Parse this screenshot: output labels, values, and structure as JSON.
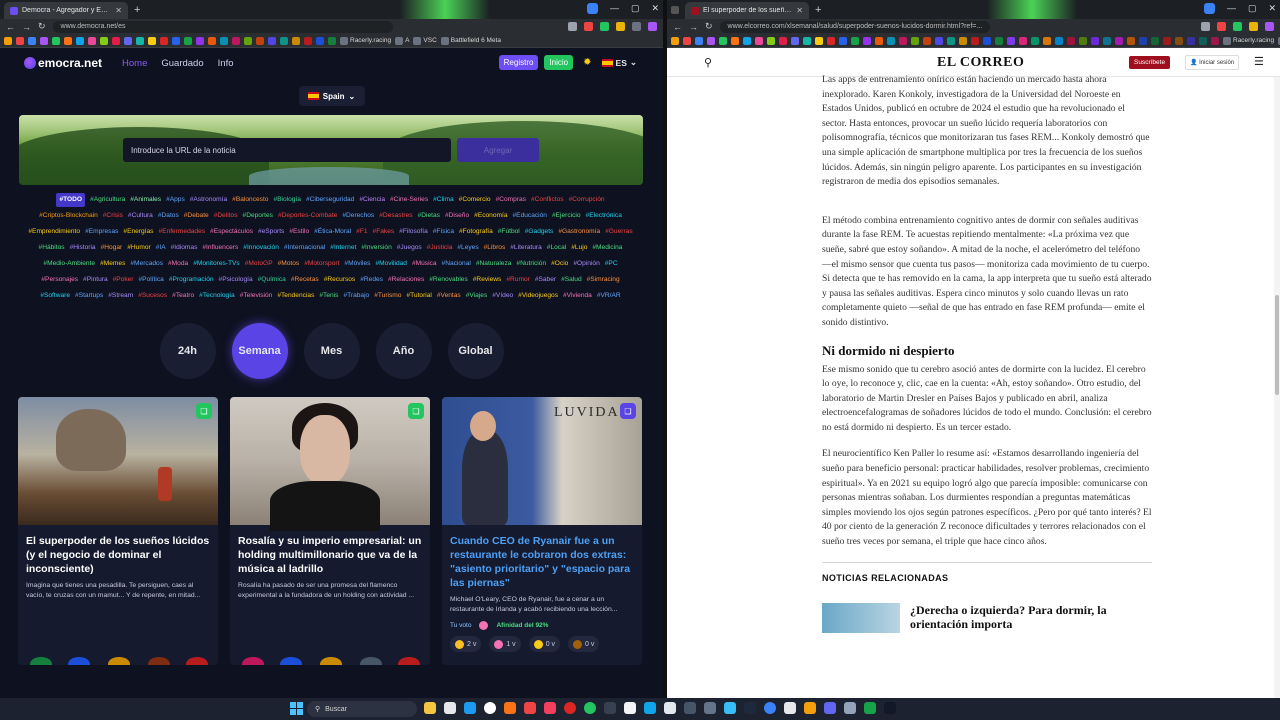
{
  "left_browser": {
    "tab_title": "Democra - Agregador y Evalua...",
    "url": "www.democra.net/es",
    "bookmarks": [
      "Racerly.racing",
      "A",
      "VSC",
      "Battlefield 6 Meta"
    ]
  },
  "right_browser": {
    "tab_title": "El superpoder de los sueños lú...",
    "url": "www.elcorreo.com/xlsemanal/salud/superpoder-suenos-lucidos-dormir.html?ref=...",
    "bookmarks": [
      "Racerly.racing",
      "A"
    ]
  },
  "democra": {
    "logo": "emocra.net",
    "nav": {
      "home": "Home",
      "saved": "Guardado",
      "info": "Info"
    },
    "register": "Registro",
    "login": "Inicio",
    "lang": "ES",
    "country": "Spain",
    "url_placeholder": "Introduce la URL de la noticia",
    "add_button": "Agregar",
    "tags": [
      {
        "t": "#TODO",
        "c": "#ffffff"
      },
      {
        "t": "#Agricultura",
        "c": "#4ade80"
      },
      {
        "t": "#Animales",
        "c": "#86efac"
      },
      {
        "t": "#Apps",
        "c": "#60a5fa"
      },
      {
        "t": "#Astronomía",
        "c": "#a78bfa"
      },
      {
        "t": "#Baloncesto",
        "c": "#fb923c"
      },
      {
        "t": "#Biología",
        "c": "#34d399"
      },
      {
        "t": "#Ciberseguridad",
        "c": "#60a5fa"
      },
      {
        "t": "#Ciencia",
        "c": "#c084fc"
      },
      {
        "t": "#Cine-Series",
        "c": "#f472b6"
      },
      {
        "t": "#Clima",
        "c": "#22d3ee"
      },
      {
        "t": "#Comercio",
        "c": "#facc15"
      },
      {
        "t": "#Compras",
        "c": "#f472b6"
      },
      {
        "t": "#Conflictos",
        "c": "#ef4444"
      },
      {
        "t": "#Corrupción",
        "c": "#ef4444"
      },
      {
        "t": "#Criptos-Blockchain",
        "c": "#f59e0b"
      },
      {
        "t": "#Crisis",
        "c": "#ef4444"
      },
      {
        "t": "#Cultura",
        "c": "#a78bfa"
      },
      {
        "t": "#Datos",
        "c": "#60a5fa"
      },
      {
        "t": "#Debate",
        "c": "#fb923c"
      },
      {
        "t": "#Delitos",
        "c": "#ef4444"
      },
      {
        "t": "#Deportes",
        "c": "#4ade80"
      },
      {
        "t": "#Deportes-Combate",
        "c": "#ef4444"
      },
      {
        "t": "#Derechos",
        "c": "#60a5fa"
      },
      {
        "t": "#Desastres",
        "c": "#ef4444"
      },
      {
        "t": "#Dietas",
        "c": "#4ade80"
      },
      {
        "t": "#Diseño",
        "c": "#f472b6"
      },
      {
        "t": "#Economía",
        "c": "#facc15"
      },
      {
        "t": "#Educación",
        "c": "#60a5fa"
      },
      {
        "t": "#Ejercicio",
        "c": "#4ade80"
      },
      {
        "t": "#Electrónica",
        "c": "#22d3ee"
      },
      {
        "t": "#Emprendimiento",
        "c": "#facc15"
      },
      {
        "t": "#Empresas",
        "c": "#60a5fa"
      },
      {
        "t": "#Energías",
        "c": "#facc15"
      },
      {
        "t": "#Enfermedades",
        "c": "#ef4444"
      },
      {
        "t": "#Espectáculos",
        "c": "#f472b6"
      },
      {
        "t": "#eSports",
        "c": "#a78bfa"
      },
      {
        "t": "#Estilo",
        "c": "#f472b6"
      },
      {
        "t": "#Ética-Moral",
        "c": "#60a5fa"
      },
      {
        "t": "#F1",
        "c": "#ef4444"
      },
      {
        "t": "#Fakes",
        "c": "#ef4444"
      },
      {
        "t": "#Filosofía",
        "c": "#a78bfa"
      },
      {
        "t": "#Física",
        "c": "#60a5fa"
      },
      {
        "t": "#Fotografía",
        "c": "#facc15"
      },
      {
        "t": "#Fútbol",
        "c": "#4ade80"
      },
      {
        "t": "#Gadgets",
        "c": "#22d3ee"
      },
      {
        "t": "#Gastronomía",
        "c": "#fb923c"
      },
      {
        "t": "#Guerras",
        "c": "#ef4444"
      },
      {
        "t": "#Hábitos",
        "c": "#4ade80"
      },
      {
        "t": "#Historia",
        "c": "#a78bfa"
      },
      {
        "t": "#Hogar",
        "c": "#fb923c"
      },
      {
        "t": "#Humor",
        "c": "#facc15"
      },
      {
        "t": "#IA",
        "c": "#60a5fa"
      },
      {
        "t": "#Idiomas",
        "c": "#a78bfa"
      },
      {
        "t": "#Influencers",
        "c": "#f472b6"
      },
      {
        "t": "#Innovación",
        "c": "#22d3ee"
      },
      {
        "t": "#Internacional",
        "c": "#60a5fa"
      },
      {
        "t": "#Internet",
        "c": "#22d3ee"
      },
      {
        "t": "#Inversión",
        "c": "#4ade80"
      },
      {
        "t": "#Juegos",
        "c": "#a78bfa"
      },
      {
        "t": "#Justicia",
        "c": "#ef4444"
      },
      {
        "t": "#Leyes",
        "c": "#60a5fa"
      },
      {
        "t": "#Libros",
        "c": "#fb923c"
      },
      {
        "t": "#Literatura",
        "c": "#a78bfa"
      },
      {
        "t": "#Local",
        "c": "#4ade80"
      },
      {
        "t": "#Lujo",
        "c": "#facc15"
      },
      {
        "t": "#Medicina",
        "c": "#4ade80"
      },
      {
        "t": "#Medio-Ambiente",
        "c": "#4ade80"
      },
      {
        "t": "#Memes",
        "c": "#facc15"
      },
      {
        "t": "#Mercados",
        "c": "#60a5fa"
      },
      {
        "t": "#Moda",
        "c": "#f472b6"
      },
      {
        "t": "#Monitores-TVs",
        "c": "#22d3ee"
      },
      {
        "t": "#MotoGP",
        "c": "#ef4444"
      },
      {
        "t": "#Motos",
        "c": "#fb923c"
      },
      {
        "t": "#Motorsport",
        "c": "#ef4444"
      },
      {
        "t": "#Móviles",
        "c": "#60a5fa"
      },
      {
        "t": "#Movilidad",
        "c": "#22d3ee"
      },
      {
        "t": "#Música",
        "c": "#f472b6"
      },
      {
        "t": "#Nacional",
        "c": "#60a5fa"
      },
      {
        "t": "#Naturaleza",
        "c": "#4ade80"
      },
      {
        "t": "#Nutrición",
        "c": "#4ade80"
      },
      {
        "t": "#Ocio",
        "c": "#facc15"
      },
      {
        "t": "#Opinión",
        "c": "#a78bfa"
      },
      {
        "t": "#PC",
        "c": "#22d3ee"
      },
      {
        "t": "#Personajes",
        "c": "#f472b6"
      },
      {
        "t": "#Pintura",
        "c": "#a78bfa"
      },
      {
        "t": "#Poker",
        "c": "#ef4444"
      },
      {
        "t": "#Política",
        "c": "#60a5fa"
      },
      {
        "t": "#Programación",
        "c": "#22d3ee"
      },
      {
        "t": "#Psicología",
        "c": "#a78bfa"
      },
      {
        "t": "#Química",
        "c": "#34d399"
      },
      {
        "t": "#Recetas",
        "c": "#fb923c"
      },
      {
        "t": "#Recursos",
        "c": "#facc15"
      },
      {
        "t": "#Redes",
        "c": "#60a5fa"
      },
      {
        "t": "#Relaciones",
        "c": "#f472b6"
      },
      {
        "t": "#Renovables",
        "c": "#4ade80"
      },
      {
        "t": "#Reviews",
        "c": "#facc15"
      },
      {
        "t": "#Rumor",
        "c": "#ef4444"
      },
      {
        "t": "#Saber",
        "c": "#a78bfa"
      },
      {
        "t": "#Salud",
        "c": "#4ade80"
      },
      {
        "t": "#Simracing",
        "c": "#fb923c"
      },
      {
        "t": "#Software",
        "c": "#22d3ee"
      },
      {
        "t": "#Startups",
        "c": "#60a5fa"
      },
      {
        "t": "#Stream",
        "c": "#a78bfa"
      },
      {
        "t": "#Sucesos",
        "c": "#ef4444"
      },
      {
        "t": "#Teatro",
        "c": "#f472b6"
      },
      {
        "t": "#Tecnología",
        "c": "#22d3ee"
      },
      {
        "t": "#Televisión",
        "c": "#f472b6"
      },
      {
        "t": "#Tendencias",
        "c": "#facc15"
      },
      {
        "t": "#Tenis",
        "c": "#4ade80"
      },
      {
        "t": "#Trabajo",
        "c": "#60a5fa"
      },
      {
        "t": "#Turismo",
        "c": "#fb923c"
      },
      {
        "t": "#Tutorial",
        "c": "#facc15"
      },
      {
        "t": "#Ventas",
        "c": "#fb923c"
      },
      {
        "t": "#Viajes",
        "c": "#4ade80"
      },
      {
        "t": "#Vídeo",
        "c": "#a78bfa"
      },
      {
        "t": "#Videojuegos",
        "c": "#facc15"
      },
      {
        "t": "#Vivienda",
        "c": "#f472b6"
      },
      {
        "t": "#VR/AR",
        "c": "#60a5fa"
      }
    ],
    "periods": [
      "24h",
      "Semana",
      "Mes",
      "Año",
      "Global"
    ],
    "active_period": "Semana",
    "cards": [
      {
        "title": "El superpoder de los sueños lúcidos (y el negocio de dominar el inconsciente)",
        "summary": "Imagina que tienes una pesadilla. Te persiguen, caes al vacío, te cruzas con un mamut... Y de repente, en mitad...",
        "bookmark_color": "#22c55e"
      },
      {
        "title": "Rosalía y su imperio empresarial: un holding multimillonario que va de la música al ladrillo",
        "summary": "Rosalía ha pasado de ser una promesa del flamenco experimental a la fundadora de un holding con actividad ...",
        "bookmark_color": "#22c55e"
      },
      {
        "title": "Cuando CEO de Ryanair fue a un restaurante le cobraron dos extras: \"asiento prioritario\" y \"espacio para las piernas\"",
        "summary": "Michael O'Leary, CEO de Ryanair, fue a cenar a un restaurante de Irlanda y acabó recibiendo una lección...",
        "bookmark_color": "#5b44e6",
        "your_vote": "Tu voto",
        "affinity": "Afinidad del 92%",
        "sign": "LUVIDA",
        "reactions": [
          "2 v",
          "1 v",
          "0 v",
          "0 v"
        ]
      }
    ]
  },
  "elcorreo": {
    "logo": "EL CORREO",
    "subscribe": "Suscríbete",
    "login": "Iniciar sesión",
    "p1": "Las apps de entrenamiento onírico están haciendo un mercado hasta ahora inexplorado. Karen Konkoly, investigadora de la Universidad del Noroeste en Estados Unidos, publicó en octubre de 2024 el estudio que ha revolucionado el sector. Hasta entonces, provocar un sueño lúcido requería laboratorios con polisomnografía, técnicos que monitorizaran tus fases REM... Konkoly demostró que una simple aplicación de smartphone multiplica por tres la frecuencia de los sueños lúcidos. Además, sin ningún peligro aparente. Los participantes en su investigación registraron de media dos episodios semanales.",
    "p2": "El método combina entrenamiento cognitivo antes de dormir con señales auditivas durante la fase REM. Te acuestas repitiendo mentalmente: «La próxima vez que sueñe, sabré que estoy soñando». A mitad de la noche, el acelerómetro del teléfono —el mismo sensor que cuenta tus pasos— monitoriza cada movimiento de tu cuerpo. Si detecta que te has removido en la cama, la app interpreta que tu sueño está alterado y pausa las señales auditivas. Espera cinco minutos y solo cuando llevas un rato completamente quieto —señal de que has entrado en fase REM profunda— emite el sonido distintivo.",
    "h2": "Ni dormido ni despierto",
    "p3": "Ese mismo sonido que tu cerebro asoció antes de dormirte con la lucidez. El cerebro lo oye, lo reconoce y, clic, cae en la cuenta: «Ah, estoy soñando». Otro estudio, del laboratorio de Martin Dresler en Países Bajos y publicado en abril, analiza electroencefalogramas de soñadores lúcidos de todo el mundo. Conclusión: el cerebro no está dormido ni despierto. Es un tercer estado.",
    "p4": "El neurocientífico Ken Paller lo resume así: «Estamos desarrollando ingeniería del sueño para beneficio personal: practicar habilidades, resolver problemas, crecimiento espiritual». Ya en 2021 su equipo logró algo que parecía imposible: comunicarse con personas mientras soñaban. Los durmientes respondían a preguntas matemáticas simples moviendo los ojos según patrones específicos. ¿Pero por qué tanto interés? El 40 por ciento de la generación Z reconoce dificultades y terrores relacionados con el sueño tres veces por semana, el triple que hace cinco años.",
    "related_heading": "NOTICIAS RELACIONADAS",
    "related_item": "¿Derecha o izquierda? Para dormir, la orientación importa"
  },
  "taskbar": {
    "search": "Buscar"
  }
}
